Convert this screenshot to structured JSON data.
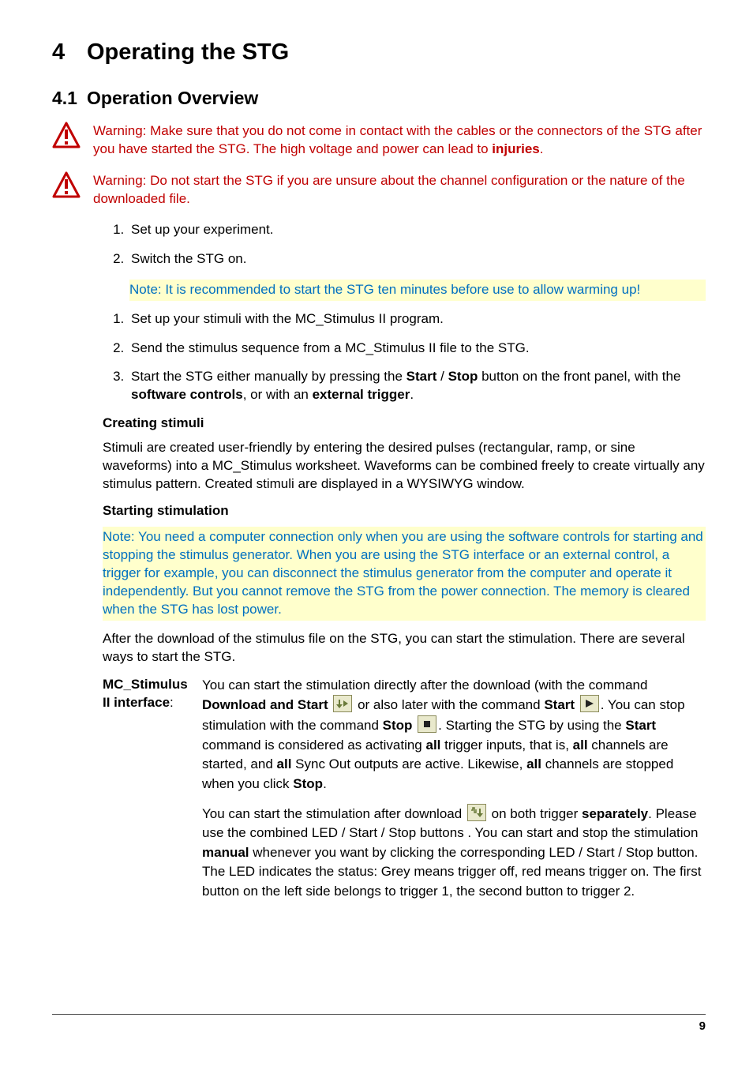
{
  "chapter": {
    "number": "4",
    "title": "Operating the STG"
  },
  "section": {
    "number": "4.1",
    "title": "Operation Overview"
  },
  "warnings": [
    {
      "prefix": "Warning: Make sure that you do not come in contact with the cables or the connectors of the STG after you have started the STG. The high voltage and power can lead to ",
      "bold": "injuries",
      "suffix": "."
    },
    {
      "prefix": "Warning: Do not start the STG if you are unsure about the channel configuration or the nature of the downloaded file.",
      "bold": "",
      "suffix": ""
    }
  ],
  "stepsA": [
    "Set up your experiment.",
    "Switch the STG on."
  ],
  "note_warmup": "Note: It is recommended to start the STG ten minutes before use to allow warming up!",
  "stepsB": [
    "Set up your stimuli with the MC_Stimulus II program.",
    "Send the stimulus sequence from a MC_Stimulus II file to the STG.",
    {
      "pre": "Start the STG either manually by pressing the ",
      "b1": "Start",
      "mid1": " / ",
      "b2": "Stop",
      "mid2": " button on the front panel, with the ",
      "b3": "software controls",
      "mid3": ", or with an ",
      "b4": "external trigger",
      "post": "."
    }
  ],
  "creating": {
    "heading": "Creating stimuli",
    "body": "Stimuli are created user-friendly by entering the desired pulses (rectangular, ramp, or sine waveforms) into a MC_Stimulus worksheet. Waveforms can be combined freely to create virtually any stimulus pattern. Created stimuli are displayed in a WYSIWYG window."
  },
  "starting": {
    "heading": "Starting stimulation",
    "note": "Note: You need a computer connection only when you are using the software controls for starting and stopping the stimulus generator. When you are using the STG interface or an external control, a trigger for example, you can disconnect the stimulus generator from the computer and operate it independently. But you cannot remove the STG from the power connection. The memory is cleared when the STG has lost power.",
    "after": "After the download of the stimulus file on the STG, you can start the stimulation. There are several ways to start the STG."
  },
  "iface": {
    "label1": "MC_Stimulus",
    "label2": "II interface",
    "colon": ":",
    "p1_a": "You can start the stimulation directly after the download (with the command ",
    "p1_b": "Download and Start",
    "p1_c": " or also later with the command ",
    "p1_d": "Start",
    "p1_e": ". You can stop stimulation with the command ",
    "p1_f": "Stop",
    "p1_g": ". Starting the STG by using the ",
    "p1_h": "Start",
    "p1_i": " command is considered as activating ",
    "p1_j": "all",
    "p1_k": " trigger inputs, that is, ",
    "p1_l": "all",
    "p1_m": " channels are started, and ",
    "p1_n": "all",
    "p1_o": " Sync Out outputs are active. Likewise, ",
    "p1_p": "all",
    "p1_q": " channels are stopped when you click ",
    "p1_r": "Stop",
    "p1_s": ".",
    "p2_a": "You can start the stimulation after download ",
    "p2_b": " on both trigger ",
    "p2_c": "separately",
    "p2_d": ". Please use the combined LED / Start / Stop buttons . You can start and stop the stimulation ",
    "p2_e": "manual",
    "p2_f": " whenever you want by clicking the corresponding LED / Start / Stop button. The LED indicates the status: Grey means trigger off, red means trigger on. The first button on the left side belongs to trigger 1, the second button to trigger 2."
  },
  "page_number": "9"
}
